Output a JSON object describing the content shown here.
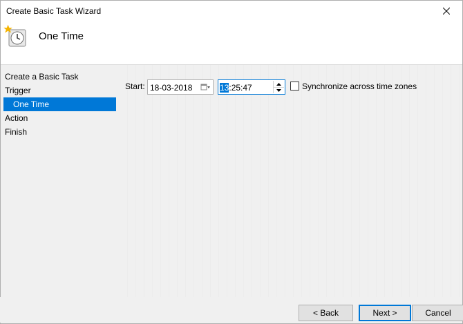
{
  "window": {
    "title": "Create Basic Task Wizard"
  },
  "header": {
    "title": "One Time"
  },
  "nav": {
    "items": [
      {
        "label": "Create a Basic Task"
      },
      {
        "label": "Trigger"
      },
      {
        "label": "One Time"
      },
      {
        "label": "Action"
      },
      {
        "label": "Finish"
      }
    ]
  },
  "start": {
    "label": "Start:",
    "date": "18-03-2018",
    "time_hour": "13",
    "time_rest": ":25:47",
    "sync_label": "Synchronize across time zones",
    "sync_checked": false
  },
  "buttons": {
    "back": "< Back",
    "next": "Next >",
    "cancel": "Cancel"
  },
  "colors": {
    "accent": "#0078d7",
    "selected_nav_bg": "#0078d7"
  },
  "icons": [
    "close-icon",
    "scheduled-task-clock-icon",
    "calendar-dropdown-icon",
    "spin-up-icon",
    "spin-down-icon"
  ]
}
